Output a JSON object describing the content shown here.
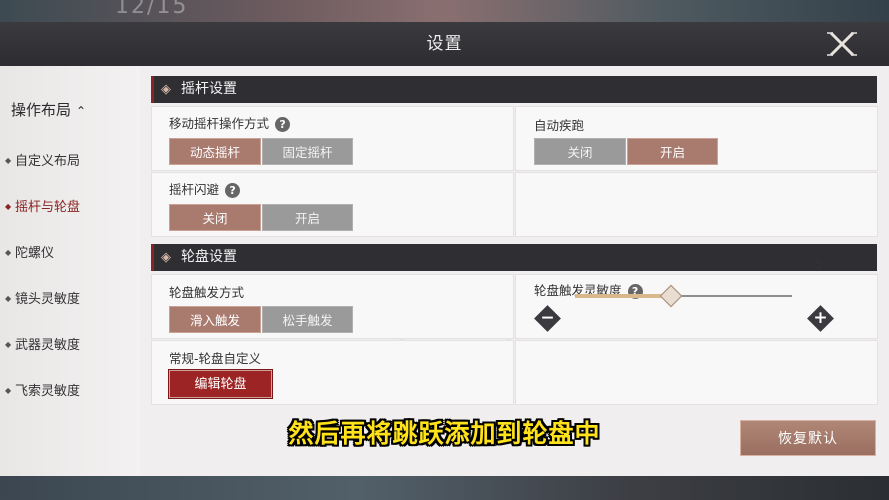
{
  "background": {
    "top_text": "12/15"
  },
  "header": {
    "title": "设置"
  },
  "sidebar": {
    "section_label": "操作布局",
    "items": [
      {
        "label": "自定义布局"
      },
      {
        "label": "摇杆与轮盘"
      },
      {
        "label": "陀螺仪"
      },
      {
        "label": "镜头灵敏度"
      },
      {
        "label": "武器灵敏度"
      },
      {
        "label": "飞索灵敏度"
      }
    ],
    "active_index": 1
  },
  "joystick_section": {
    "title": "摇杆设置",
    "move_mode": {
      "label": "移动摇杆操作方式",
      "options": [
        "动态摇杆",
        "固定摇杆"
      ],
      "selected": "动态摇杆"
    },
    "auto_sprint": {
      "label": "自动疾跑",
      "options": [
        "关闭",
        "开启"
      ],
      "selected": "开启"
    },
    "dodge": {
      "label": "摇杆闪避",
      "options": [
        "关闭",
        "开启"
      ],
      "selected": "关闭"
    }
  },
  "wheel_section": {
    "title": "轮盘设置",
    "trigger_mode": {
      "label": "轮盘触发方式",
      "options": [
        "滑入触发",
        "松手触发"
      ],
      "selected": "滑入触发"
    },
    "sensitivity": {
      "label": "轮盘触发灵敏度",
      "value": "5",
      "fraction": 0.44
    },
    "custom": {
      "label": "常规-轮盘自定义",
      "button": "编辑轮盘"
    }
  },
  "footer": {
    "restore_button": "恢复默认"
  },
  "subtitle": "然后再将跳跃添加到轮盘中",
  "colors": {
    "accent": "#8a2323",
    "selected": "#a97a6e",
    "unselected": "#9a9a9a",
    "subtitle": "#ffe21a"
  }
}
